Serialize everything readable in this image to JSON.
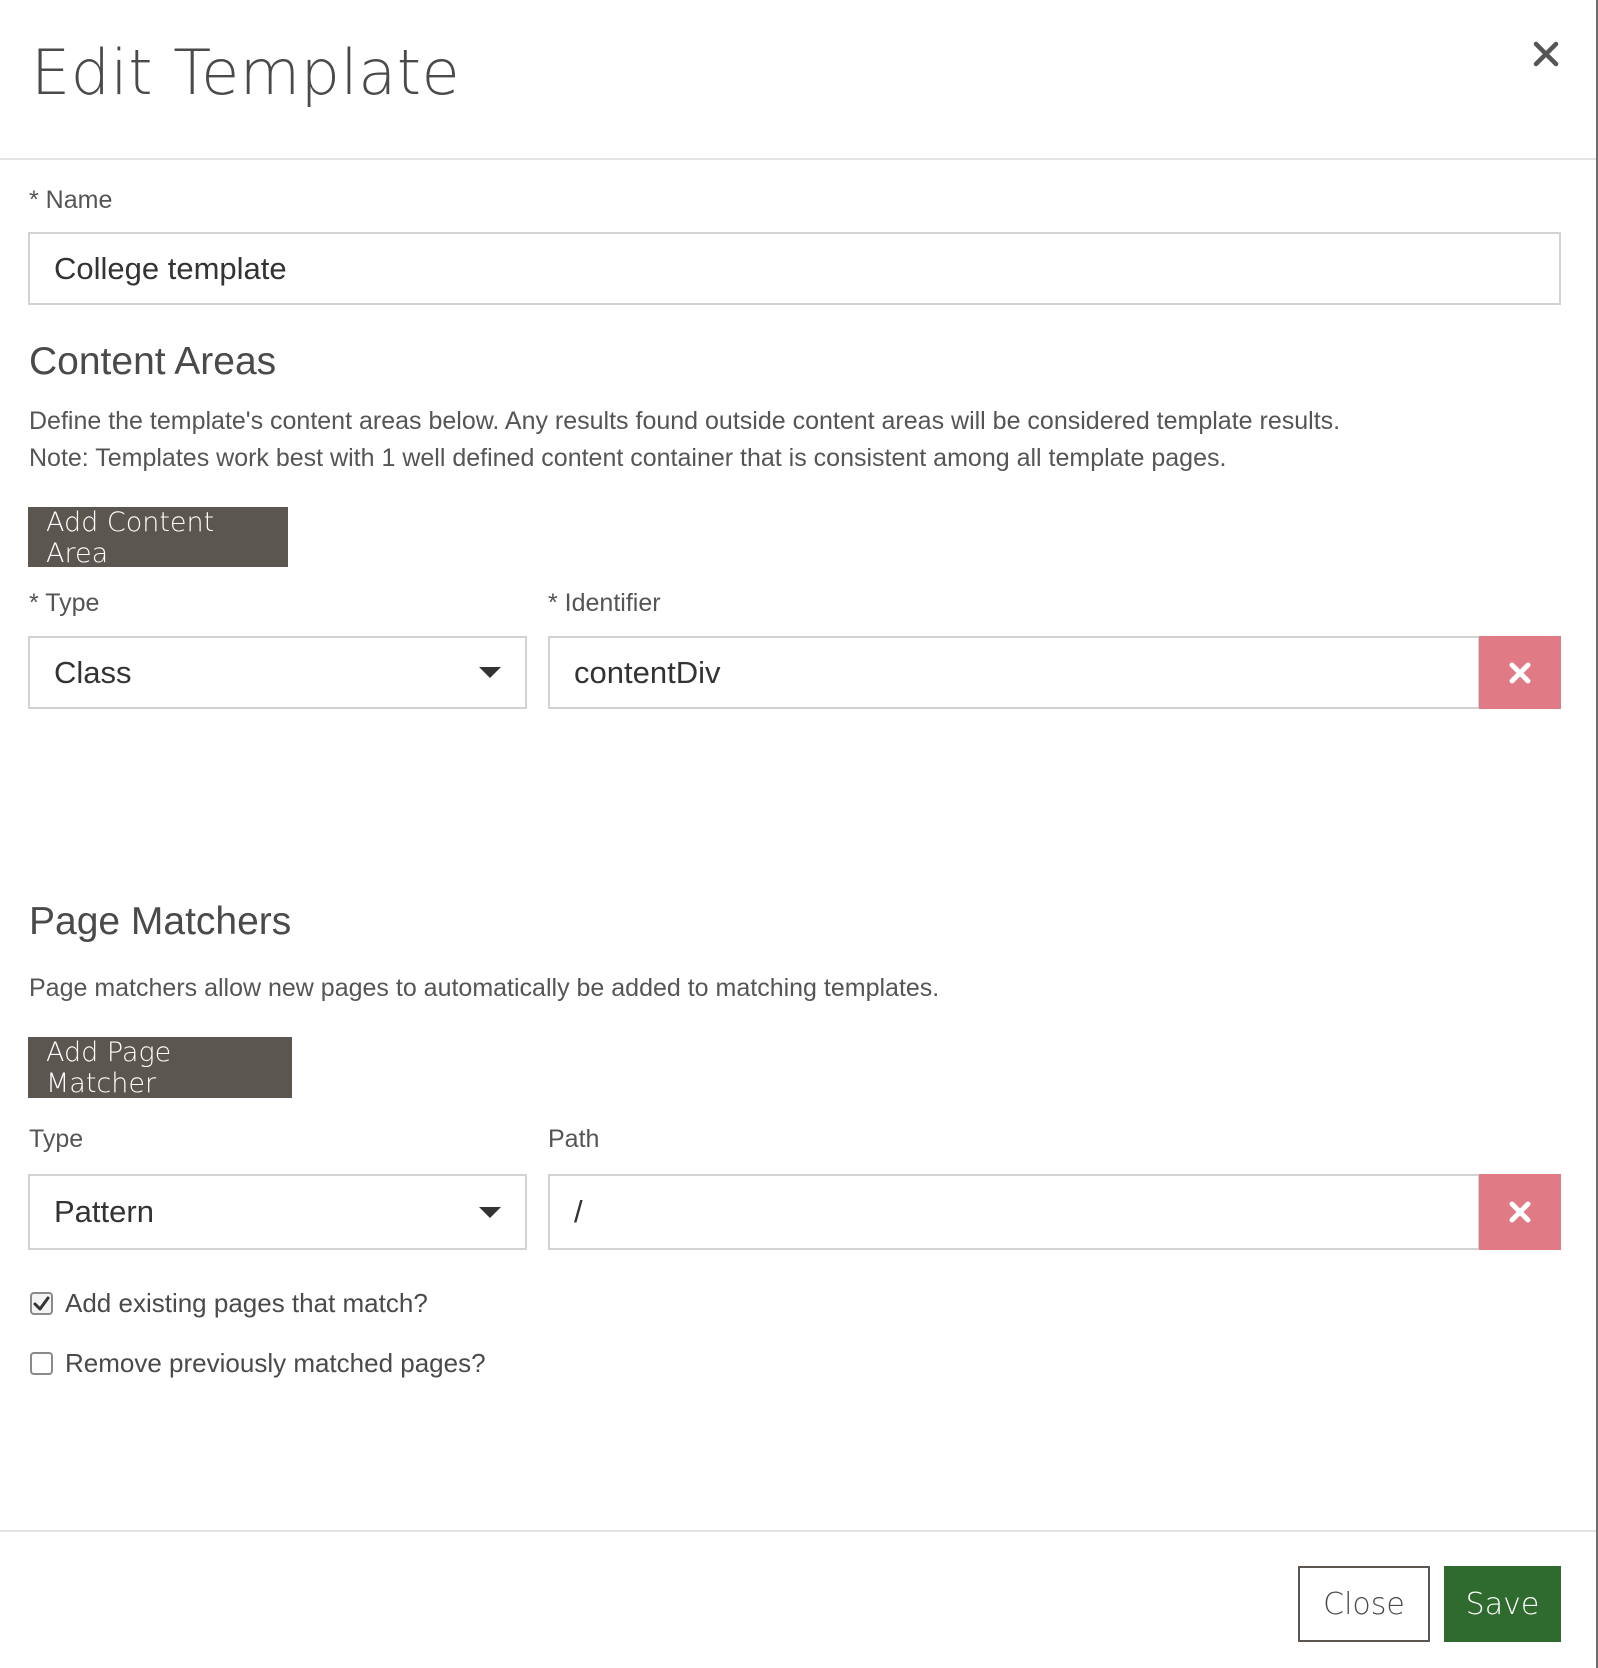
{
  "modal": {
    "title": "Edit Template",
    "close_icon": "close-icon"
  },
  "name_field": {
    "label": "* Name",
    "value": "College template"
  },
  "content_areas": {
    "title": "Content Areas",
    "description_line1": "Define the template's content areas below. Any results found outside content areas will be considered template results.",
    "description_line2": "Note: Templates work best with 1 well defined content container that is consistent among all template pages.",
    "add_button": "Add Content Area",
    "type_label": "* Type",
    "identifier_label": "* Identifier",
    "rows": [
      {
        "type": "Class",
        "identifier": "contentDiv"
      }
    ]
  },
  "page_matchers": {
    "title": "Page Matchers",
    "description": "Page matchers allow new pages to automatically be added to matching templates.",
    "add_button": "Add Page Matcher",
    "type_label": "Type",
    "path_label": "Path",
    "rows": [
      {
        "type": "Pattern",
        "path": "/"
      }
    ],
    "options": [
      {
        "label": "Add existing pages that match?",
        "checked": true
      },
      {
        "label": "Remove previously matched pages?",
        "checked": false
      }
    ]
  },
  "footer": {
    "close_label": "Close",
    "save_label": "Save"
  },
  "colors": {
    "primary_dark": "#5b5650",
    "danger": "#e07a85",
    "save": "#2f6b2f"
  }
}
